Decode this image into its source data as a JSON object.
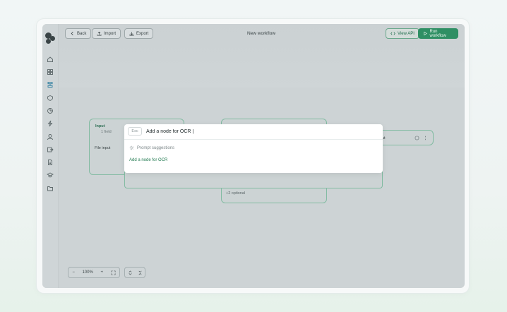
{
  "toolbar": {
    "back_label": "Back",
    "import_label": "Import",
    "export_label": "Export",
    "title": "New workflow",
    "view_api_label": "View API",
    "run_label": "Run workflow"
  },
  "sidebar": {
    "icons": [
      "home-icon",
      "grid-icon",
      "workflow-icon",
      "shield-icon",
      "chart-icon",
      "bolt-icon",
      "user-icon",
      "export-icon",
      "document-icon",
      "graduation-icon",
      "folder-icon"
    ]
  },
  "nodes": {
    "input_title": "Input",
    "input_subtitle": "1 field",
    "file_input_label": "File input",
    "middle_optional": "+2 optional",
    "right_partial": "ut"
  },
  "palette": {
    "esc_label": "Esc",
    "query": "Add a node for OCR |",
    "suggestions_header": "Prompt suggestions",
    "suggestion": "Add a node for OCR"
  },
  "zoom": {
    "level": "100%",
    "minus": "−",
    "plus": "+"
  },
  "colors": {
    "accent": "#2f8f64",
    "node_border": "#82bba2"
  }
}
